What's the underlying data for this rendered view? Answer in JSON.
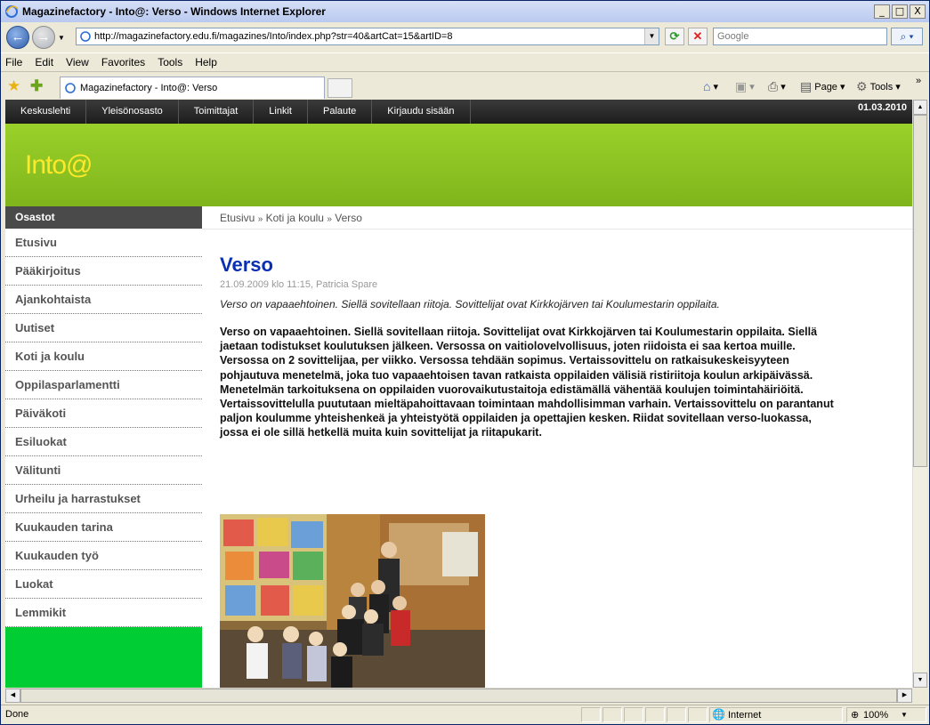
{
  "window": {
    "title": "Magazinefactory - Into@: Verso - Windows Internet Explorer",
    "min": "_",
    "max": "□",
    "close": "X"
  },
  "address": {
    "url": "http://magazinefactory.edu.fi/magazines/Into/index.php?str=40&artCat=15&artID=8",
    "search_placeholder": "Google"
  },
  "menu": [
    "File",
    "Edit",
    "View",
    "Favorites",
    "Tools",
    "Help"
  ],
  "tab": {
    "title": "Magazinefactory - Into@: Verso"
  },
  "commandbar": {
    "page": "Page",
    "tools": "Tools"
  },
  "site": {
    "topnav": [
      "Keskuslehti",
      "Yleisönosasto",
      "Toimittajat",
      "Linkit",
      "Palaute",
      "Kirjaudu sisään"
    ],
    "date": "01.03.2010",
    "logo": "Into@",
    "sidebar_header": "Osastot",
    "sidebar": [
      "Etusivu",
      "Pääkirjoitus",
      "Ajankohtaista",
      "Uutiset",
      "Koti ja koulu",
      "Oppilasparlamentti",
      "Päiväkoti",
      "Esiluokat",
      "Välitunti",
      "Urheilu ja harrastukset",
      "Kuukauden tarina",
      "Kuukauden työ",
      "Luokat",
      "Lemmikit"
    ],
    "breadcrumb": [
      "Etusivu",
      "Koti ja koulu",
      "Verso"
    ],
    "breadcrumb_sep": "»",
    "article": {
      "title": "Verso",
      "meta": "21.09.2009 klo 11:15, Patricia Spare",
      "lead": "Verso on vapaaehtoinen. Siellä sovitellaan riitoja. Sovittelijat ovat Kirkkojärven tai Koulumestarin oppilaita.",
      "body": "Verso on vapaaehtoinen. Siellä sovitellaan riitoja. Sovittelijat ovat Kirkkojärven tai Koulumestarin oppilaita. Siellä jaetaan todistukset koulutuksen jälkeen. Versossa on vaitiolovelvollisuus, joten riidoista ei saa kertoa muille. Versossa on 2 sovittelijaa, per viikko. Versossa tehdään sopimus. Vertaissovittelu on ratkaisukeskeisyyteen pohjautuva menetelmä, joka tuo vapaaehtoisen tavan ratkaista oppilaiden välisiä ristiriitoja koulun arkipäivässä. Menetelmän tarkoituksena on oppilaiden vuorovaikutustaitoja edistämällä vähentää koulujen toimintahäiriöitä. Vertaissovittelulla puututaan mieltäpahoittavaan toimintaan mahdollisimman varhain. Vertaissovittelu on parantanut paljon koulumme yhteishenkeä ja yhteistyötä oppilaiden ja opettajien kesken. Riidat sovitellaan verso-luokassa, jossa ei ole sillä hetkellä muita kuin sovittelijat ja riitapukarit."
    }
  },
  "status": {
    "text": "Done",
    "zone": "Internet",
    "zoom": "100%"
  }
}
